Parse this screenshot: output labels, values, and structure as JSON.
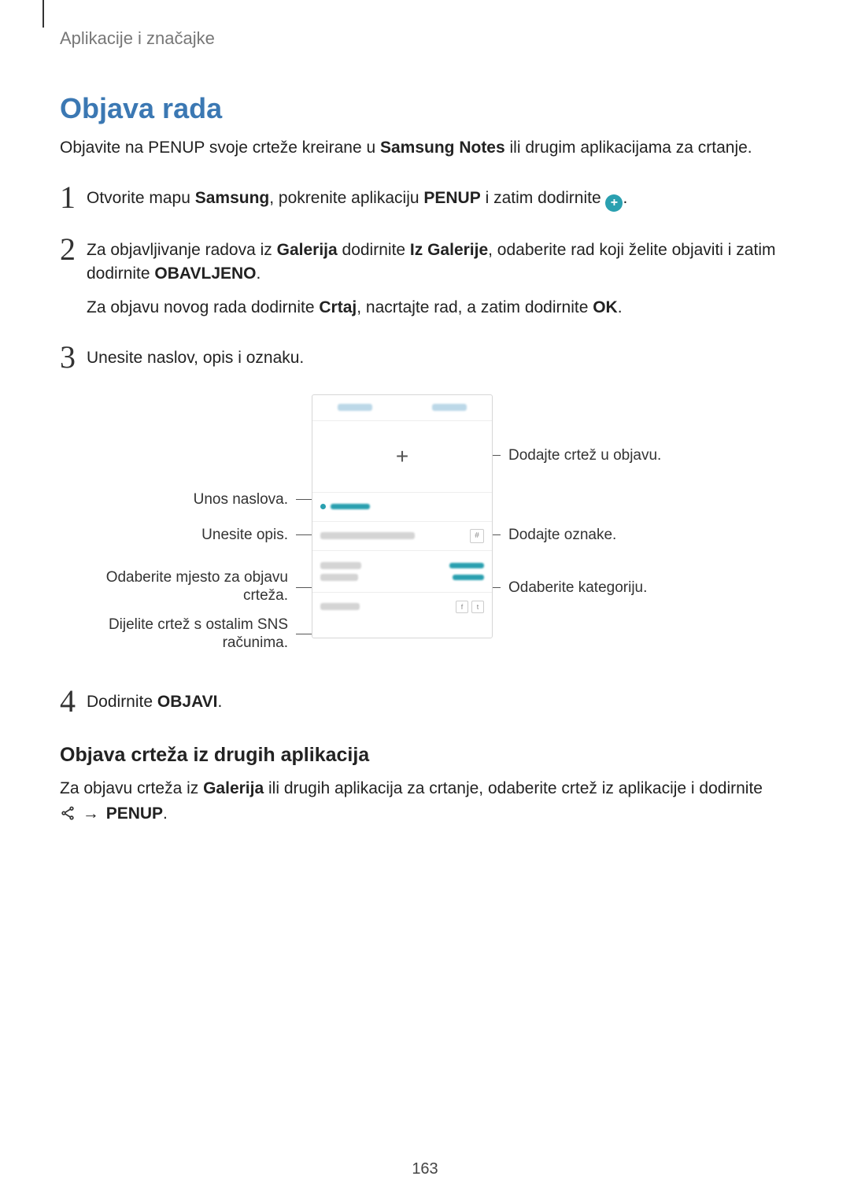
{
  "header": {
    "label": "Aplikacije i značajke"
  },
  "section": {
    "title": "Objava rada",
    "intro_pre": "Objavite na PENUP svoje crteže kreirane u ",
    "intro_bold": "Samsung Notes",
    "intro_post": " ili drugim aplikacijama za crtanje."
  },
  "steps": {
    "s1": {
      "num": "1",
      "pre": "Otvorite mapu ",
      "b1": "Samsung",
      "mid": ", pokrenite aplikaciju ",
      "b2": "PENUP",
      "post": " i zatim dodirnite ",
      "plus": "+",
      "end": "."
    },
    "s2": {
      "num": "2",
      "p1_pre": "Za objavljivanje radova iz ",
      "p1_b1": "Galerija",
      "p1_mid1": " dodirnite ",
      "p1_b2": "Iz Galerije",
      "p1_mid2": ", odaberite rad koji želite objaviti i zatim dodirnite ",
      "p1_b3": "OBAVLJENO",
      "p1_end": ".",
      "p2_pre": "Za objavu novog rada dodirnite ",
      "p2_b1": "Crtaj",
      "p2_mid": ", nacrtajte rad, a zatim dodirnite ",
      "p2_b2": "OK",
      "p2_end": "."
    },
    "s3": {
      "num": "3",
      "text": "Unesite naslov, opis i oznaku."
    },
    "s4": {
      "num": "4",
      "pre": "Dodirnite ",
      "b1": "OBJAVI",
      "end": "."
    }
  },
  "diagram": {
    "left": {
      "title": "Unos naslova.",
      "desc": "Unesite opis.",
      "loc1": "Odaberite mjesto za objavu",
      "loc2": "crteža.",
      "sns1": "Dijelite crtež s ostalim SNS",
      "sns2": "računima."
    },
    "right": {
      "add": "Dodajte crtež u objavu.",
      "tag": "Dodajte oznake.",
      "cat": "Odaberite kategoriju."
    },
    "phone": {
      "plus": "+",
      "hash": "#",
      "fb": "f",
      "tw": "t"
    }
  },
  "sub": {
    "heading": "Objava crteža iz drugih aplikacija",
    "p_pre": "Za objavu crteža iz ",
    "p_b1": "Galerija",
    "p_mid": " ili drugih aplikacija za crtanje, odaberite crtež iz aplikacije i dodirnite ",
    "arrow": "→",
    "p_b2": "PENUP",
    "p_end": "."
  },
  "page_number": "163"
}
